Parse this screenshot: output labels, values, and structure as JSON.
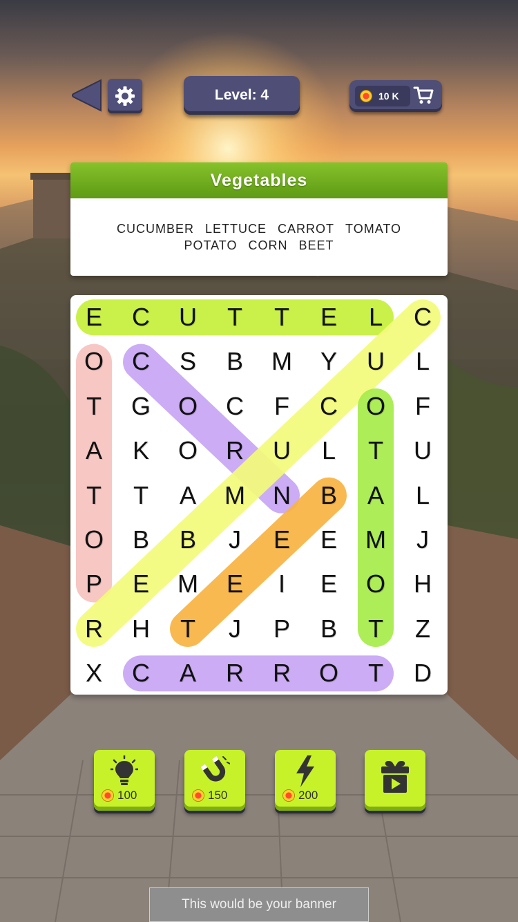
{
  "header": {
    "level_label": "Level: 4",
    "coins": "10 K"
  },
  "category": {
    "title": "Vegetables",
    "words": [
      "CUCUMBER",
      "LETTUCE",
      "CARROT",
      "TOMATO",
      "POTATO",
      "CORN",
      "BEET"
    ]
  },
  "grid": {
    "rows": [
      [
        "E",
        "C",
        "U",
        "T",
        "T",
        "E",
        "L",
        "C"
      ],
      [
        "O",
        "C",
        "S",
        "B",
        "M",
        "Y",
        "U",
        "L"
      ],
      [
        "T",
        "G",
        "O",
        "C",
        "F",
        "C",
        "O",
        "F"
      ],
      [
        "A",
        "K",
        "O",
        "R",
        "U",
        "L",
        "T",
        "U"
      ],
      [
        "T",
        "T",
        "A",
        "M",
        "N",
        "B",
        "A",
        "L"
      ],
      [
        "O",
        "B",
        "B",
        "J",
        "E",
        "E",
        "M",
        "J"
      ],
      [
        "P",
        "E",
        "M",
        "E",
        "I",
        "E",
        "O",
        "H"
      ],
      [
        "R",
        "H",
        "T",
        "J",
        "P",
        "B",
        "T",
        "Z"
      ],
      [
        "X",
        "C",
        "A",
        "R",
        "R",
        "O",
        "T",
        "D"
      ]
    ],
    "found": [
      {
        "word": "LETTUCE",
        "from": [
          0,
          6
        ],
        "to": [
          0,
          0
        ],
        "color": "#c6f03a"
      },
      {
        "word": "POTATO",
        "from": [
          6,
          0
        ],
        "to": [
          1,
          0
        ],
        "color": "#f7c3c0"
      },
      {
        "word": "CORN",
        "from": [
          1,
          1
        ],
        "to": [
          4,
          4
        ],
        "color": "#c7a6f5"
      },
      {
        "word": "CUCUMBER",
        "from": [
          0,
          7
        ],
        "to": [
          7,
          0
        ],
        "color": "#f4fb7a"
      },
      {
        "word": "TOMATO",
        "from": [
          7,
          6
        ],
        "to": [
          2,
          6
        ],
        "color": "#a7ec4a"
      },
      {
        "word": "BEET",
        "from": [
          4,
          5
        ],
        "to": [
          7,
          2
        ],
        "color": "#f9b443"
      },
      {
        "word": "CARROT",
        "from": [
          8,
          1
        ],
        "to": [
          8,
          6
        ],
        "color": "#c7a6f5"
      }
    ]
  },
  "powerups": [
    {
      "name": "hint",
      "icon": "lightbulb-icon",
      "cost": "100"
    },
    {
      "name": "magnet",
      "icon": "magnet-icon",
      "cost": "150"
    },
    {
      "name": "lightning",
      "icon": "lightning-icon",
      "cost": "200"
    },
    {
      "name": "video-gift",
      "icon": "gift-video-icon",
      "cost": ""
    }
  ],
  "banner": {
    "text": "This would be your banner"
  }
}
